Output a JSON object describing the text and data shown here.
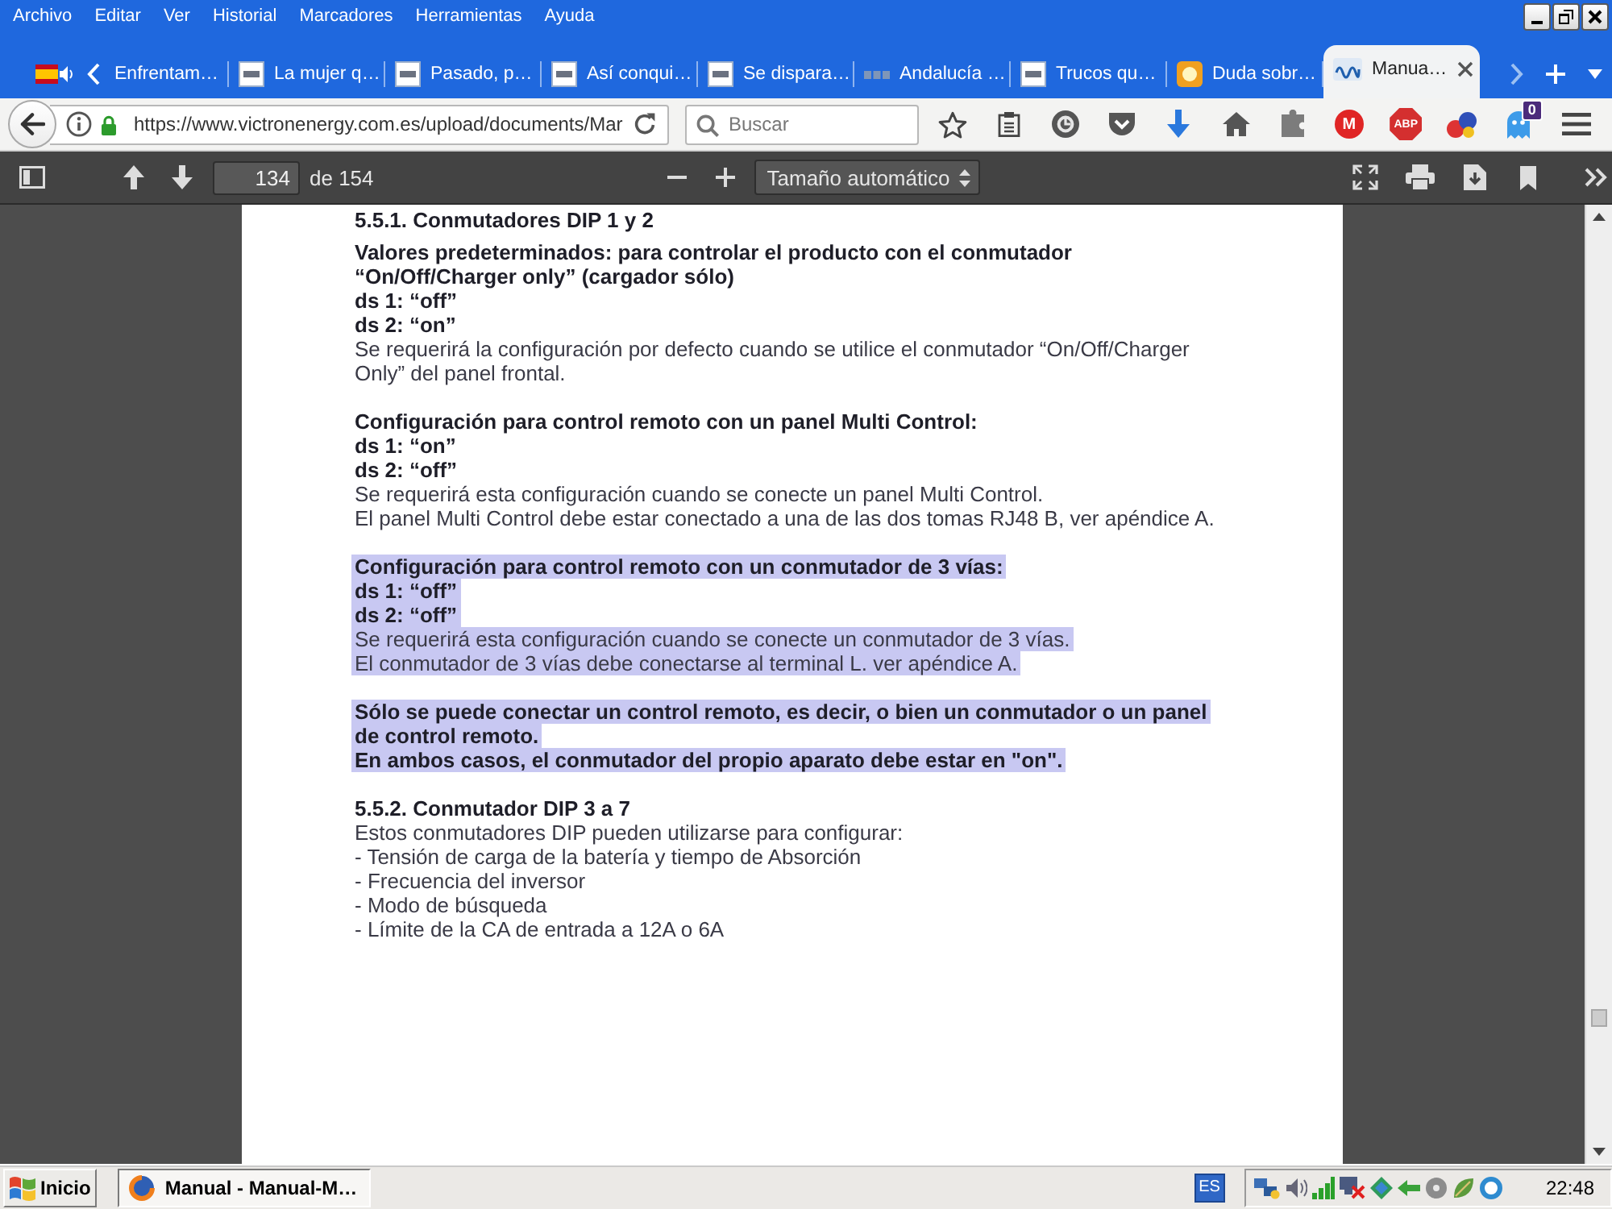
{
  "menu_bar": {
    "items": [
      "Archivo",
      "Editar",
      "Ver",
      "Historial",
      "Marcadores",
      "Herramientas",
      "Ayuda"
    ]
  },
  "tabs": [
    {
      "title": "Enfrentam…",
      "kind": "none",
      "selected": false
    },
    {
      "title": "La mujer q…",
      "kind": "tile",
      "selected": false
    },
    {
      "title": "Pasado, p…",
      "kind": "tile",
      "selected": false
    },
    {
      "title": "Así conqui…",
      "kind": "tile",
      "selected": false
    },
    {
      "title": "Se dispara…",
      "kind": "tile",
      "selected": false
    },
    {
      "title": "Andalucía …",
      "kind": "dim",
      "selected": false
    },
    {
      "title": "Trucos qu…",
      "kind": "tile",
      "selected": false
    },
    {
      "title": "Duda sobr…",
      "kind": "square",
      "selected": false
    },
    {
      "title": "Manua…",
      "kind": "logo",
      "selected": true
    }
  ],
  "nav_bar": {
    "url": "https://www.victronenergy.com.es/upload/documents/Mar",
    "search": {
      "placeholder": "Buscar"
    },
    "disc_label": "M",
    "octagon_label": "ABP",
    "notification_count": "0"
  },
  "pdf_toolbar": {
    "page_number": "134",
    "page_count": "de 154",
    "zoom": "Tamaño automático"
  },
  "document": {
    "blocks": [
      {
        "lines": [
          {
            "text": "5.5.1. Conmutadores DIP 1 y 2",
            "kind": "heading",
            "selected": false
          }
        ]
      },
      {
        "lines": [
          {
            "text": "Valores predeterminados: para controlar el producto con el conmutador",
            "kind": "bold",
            "selected": false
          },
          {
            "text": "“On/Off/Charger only” (cargador sólo)",
            "kind": "bold",
            "selected": false
          },
          {
            "text": "ds 1: “off”",
            "kind": "bold",
            "selected": false
          },
          {
            "text": "ds 2: “on”",
            "kind": "bold",
            "selected": false
          },
          {
            "text": "Se requerirá la configuración por defecto cuando se utilice el conmutador “On/Off/Charger",
            "kind": "plain",
            "selected": false
          },
          {
            "text": "Only” del panel frontal.",
            "kind": "plain",
            "selected": false
          }
        ]
      },
      {
        "lines": [
          {
            "text": "Configuración para control remoto con un panel Multi Control:",
            "kind": "bold",
            "selected": false
          },
          {
            "text": "ds 1: “on”",
            "kind": "bold",
            "selected": false
          },
          {
            "text": "ds 2: “off”",
            "kind": "bold",
            "selected": false
          },
          {
            "text": "Se requerirá esta configuración cuando se conecte un panel Multi Control.",
            "kind": "plain",
            "selected": false
          },
          {
            "text": "El panel Multi Control debe estar conectado a una de las dos tomas RJ48 B, ver apéndice A.",
            "kind": "plain",
            "selected": false
          }
        ]
      },
      {
        "lines": [
          {
            "text": "Configuración para control remoto con un conmutador de 3 vías:",
            "kind": "bold",
            "selected": true
          },
          {
            "text": "ds 1: “off”",
            "kind": "bold",
            "selected": true
          },
          {
            "text": "ds 2: “off”",
            "kind": "bold",
            "selected": true
          },
          {
            "text": "Se requerirá esta configuración cuando se conecte un conmutador de 3 vías.",
            "kind": "plain",
            "selected": true
          },
          {
            "text": "El conmutador de 3 vías debe conectarse al terminal L. ver apéndice A.",
            "kind": "plain",
            "selected": true
          }
        ]
      },
      {
        "lines": [
          {
            "text": "Sólo se puede conectar un control remoto, es decir, o bien un conmutador o un panel",
            "kind": "bold",
            "selected": true
          },
          {
            "text": "de control remoto.",
            "kind": "bold",
            "selected": true
          },
          {
            "text": "En ambos casos, el conmutador del propio aparato debe estar en \"on\".",
            "kind": "bold",
            "selected": true
          }
        ]
      },
      {
        "lines": [
          {
            "text": "5.5.2. Conmutador DIP 3 a 7",
            "kind": "heading",
            "selected": false
          },
          {
            "text": "Estos conmutadores DIP pueden utilizarse para configurar:",
            "kind": "plain",
            "selected": false
          },
          {
            "text": "- Tensión de carga de la batería y tiempo de Absorción",
            "kind": "plain",
            "selected": false
          },
          {
            "text": "- Frecuencia del inversor",
            "kind": "plain",
            "selected": false
          },
          {
            "text": "- Modo de búsqueda",
            "kind": "plain",
            "selected": false
          },
          {
            "text": "- Límite de la CA de entrada a 12A o 6A",
            "kind": "plain",
            "selected": false
          }
        ]
      }
    ]
  },
  "taskbar": {
    "start_label": "Inicio",
    "tasks": [
      {
        "title": "Manual - Manual-M…",
        "selected": true
      }
    ],
    "language": "ES",
    "clock": "22:48"
  }
}
